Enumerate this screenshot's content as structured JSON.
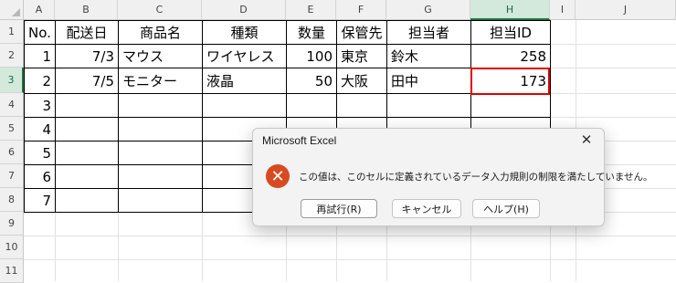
{
  "columns": [
    "A",
    "B",
    "C",
    "D",
    "E",
    "F",
    "G",
    "H",
    "I",
    "J"
  ],
  "rows": [
    "1",
    "2",
    "3",
    "4",
    "5",
    "6",
    "7",
    "8",
    "9",
    "10",
    "11"
  ],
  "table": {
    "headers": [
      "No.",
      "配送日",
      "商品名",
      "種類",
      "数量",
      "保管先",
      "担当者",
      "担当ID"
    ],
    "rows": [
      [
        "1",
        "7/3",
        "マウス",
        "ワイヤレス",
        "100",
        "東京",
        "鈴木",
        "258"
      ],
      [
        "2",
        "7/5",
        "モニター",
        "液晶",
        "50",
        "大阪",
        "田中",
        "173"
      ],
      [
        "3",
        "",
        "",
        "",
        "",
        "",
        "",
        ""
      ],
      [
        "4",
        "",
        "",
        "",
        "",
        "",
        "",
        ""
      ],
      [
        "5",
        "",
        "",
        "",
        "",
        "",
        "",
        ""
      ],
      [
        "6",
        "",
        "",
        "",
        "",
        "",
        "",
        ""
      ],
      [
        "7",
        "",
        "",
        "",
        "",
        "",
        "",
        ""
      ]
    ]
  },
  "selected_column": "H",
  "selected_row": "3",
  "dialog": {
    "title": "Microsoft Excel",
    "close_label": "✕",
    "icon": "error-icon",
    "icon_glyph": "✕",
    "message": "この値は、このセルに定義されているデータ入力規則の制限を満たしていません。",
    "buttons": [
      "再試行(R)",
      "キャンセル",
      "ヘルプ(H)"
    ]
  },
  "colors": {
    "error_accent": "#d84a21",
    "active_border": "#e00000",
    "selected_header": "#217346"
  }
}
